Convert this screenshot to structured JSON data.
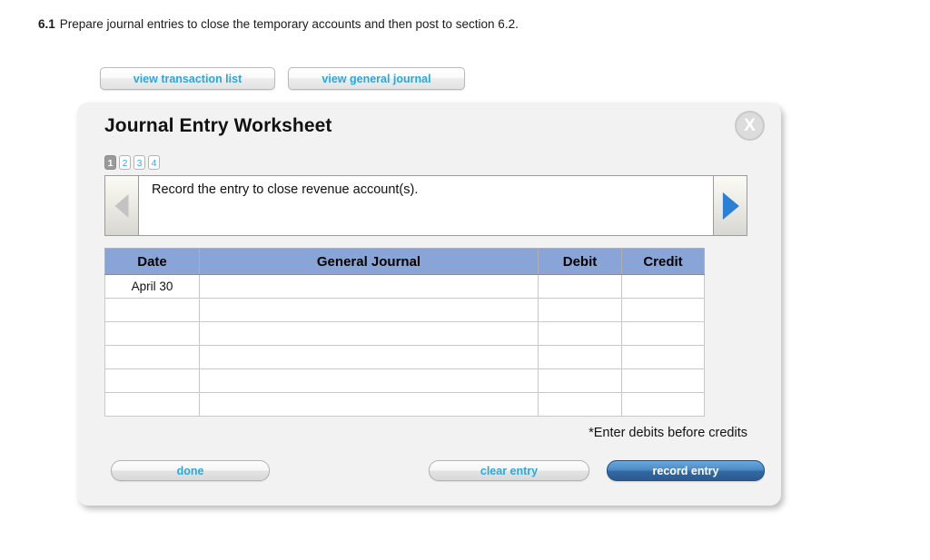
{
  "question": {
    "number": "6.1",
    "text": "Prepare journal entries to close the temporary accounts and then post to section 6.2."
  },
  "top_buttons": [
    {
      "id": "view-transaction-list",
      "label": "view transaction list"
    },
    {
      "id": "view-general-journal",
      "label": "view general journal"
    }
  ],
  "panel": {
    "title": "Journal Entry Worksheet",
    "close_label": "X"
  },
  "steps": [
    {
      "label": "1",
      "active": true
    },
    {
      "label": "2",
      "active": false
    },
    {
      "label": "3",
      "active": false
    },
    {
      "label": "4",
      "active": false
    }
  ],
  "prompt": {
    "text": "Record the entry to close revenue account(s).",
    "prev_enabled": false,
    "next_enabled": true
  },
  "table": {
    "headers": [
      "Date",
      "General Journal",
      "Debit",
      "Credit"
    ],
    "rows": [
      {
        "date": "April 30",
        "general_journal": "",
        "debit": "",
        "credit": ""
      },
      {
        "date": "",
        "general_journal": "",
        "debit": "",
        "credit": ""
      },
      {
        "date": "",
        "general_journal": "",
        "debit": "",
        "credit": ""
      },
      {
        "date": "",
        "general_journal": "",
        "debit": "",
        "credit": ""
      },
      {
        "date": "",
        "general_journal": "",
        "debit": "",
        "credit": ""
      },
      {
        "date": "",
        "general_journal": "",
        "debit": "",
        "credit": ""
      }
    ]
  },
  "note": "*Enter debits before credits",
  "footer_buttons": [
    {
      "id": "done",
      "label": "done",
      "style": "gray"
    },
    {
      "id": "clear-entry",
      "label": "clear entry",
      "style": "gray"
    },
    {
      "id": "record-entry",
      "label": "record entry",
      "style": "blue"
    }
  ],
  "colors": {
    "link_blue": "#29a8e0",
    "table_header_blue": "#89a5d7",
    "input_border_yellow": "#f2e96a",
    "next_arrow_blue": "#2b7fd4",
    "prev_arrow_gray": "#c3c3c3",
    "panel_bg": "#f2f2f2",
    "record_entry_blue": "#4a8bc9"
  }
}
